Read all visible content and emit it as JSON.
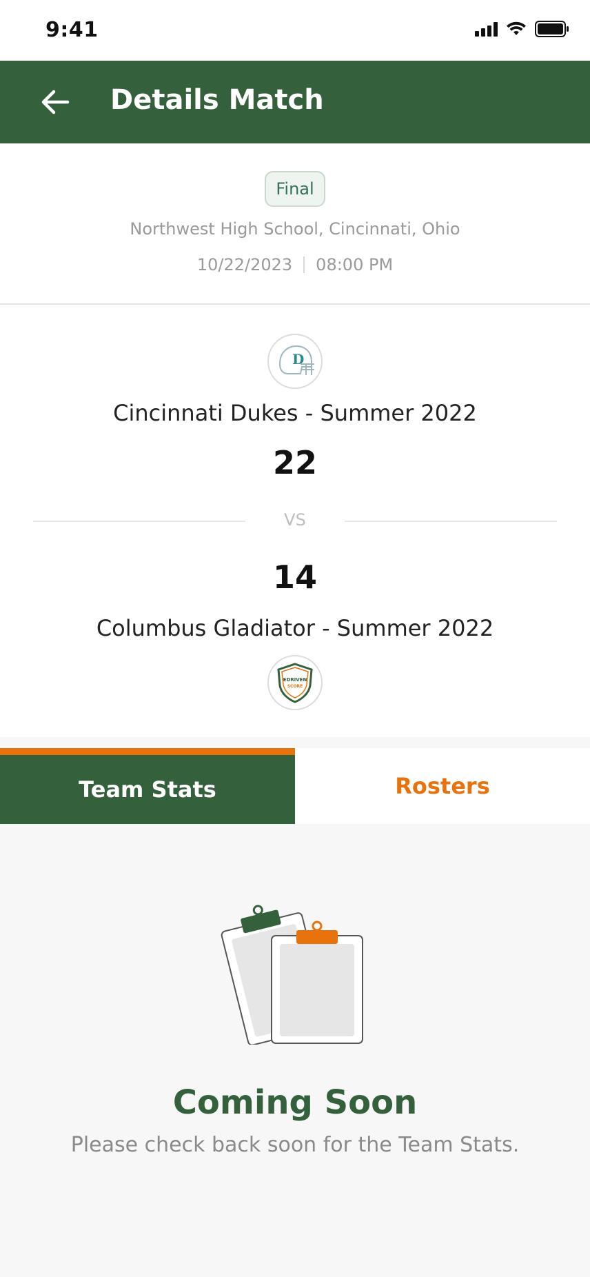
{
  "status_bar": {
    "time": "9:41"
  },
  "app_bar": {
    "title": "Details Match"
  },
  "match": {
    "status": "Final",
    "venue": "Northwest High School, Cincinnati, Ohio",
    "date": "10/22/2023",
    "time": "08:00 PM"
  },
  "home_team": {
    "name": "Cincinnati Dukes - Summer 2022",
    "score": "22",
    "logo_letter": "D"
  },
  "vs": "VS",
  "away_team": {
    "name": "Columbus Gladiator - Summer 2022",
    "score": "14",
    "logo_text_1": "EDRIVEN",
    "logo_text_2": "SCORE"
  },
  "tabs": [
    {
      "label": "Team Stats",
      "active": true
    },
    {
      "label": "Rosters",
      "active": false
    }
  ],
  "empty_state": {
    "title": "Coming Soon",
    "message": "Please check back soon for the Team Stats."
  },
  "colors": {
    "brand_green": "#35603c",
    "accent_orange": "#e8730c",
    "muted_text": "#999999"
  }
}
